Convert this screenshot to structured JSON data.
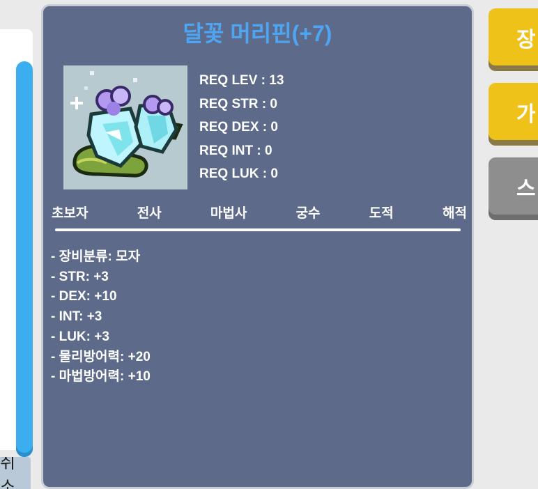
{
  "item": {
    "name": "달꽃 머리핀(+7)",
    "requirements": [
      "REQ LEV : 13",
      "REQ STR : 0",
      "REQ DEX : 0",
      "REQ INT : 0",
      "REQ LUK : 0"
    ],
    "jobs": [
      "초보자",
      "전사",
      "마법사",
      "궁수",
      "도적",
      "해적"
    ],
    "stats": [
      "- 장비분류: 모자",
      "- STR: +3",
      "- DEX: +10",
      "- INT: +3",
      "- LUK: +3",
      "- 물리방어력: +20",
      "- 마법방어력: +10"
    ]
  },
  "side_buttons": {
    "equip_label": "장",
    "buy_label": "가",
    "third_label": "스"
  },
  "left": {
    "cancel_label": "취소"
  },
  "colors": {
    "panel_bg": "#5d6a8a",
    "title": "#4ea6f3",
    "button_yellow": "#efc21a",
    "button_gray": "#8e8e8e",
    "scrollbar": "#3aaeef"
  }
}
